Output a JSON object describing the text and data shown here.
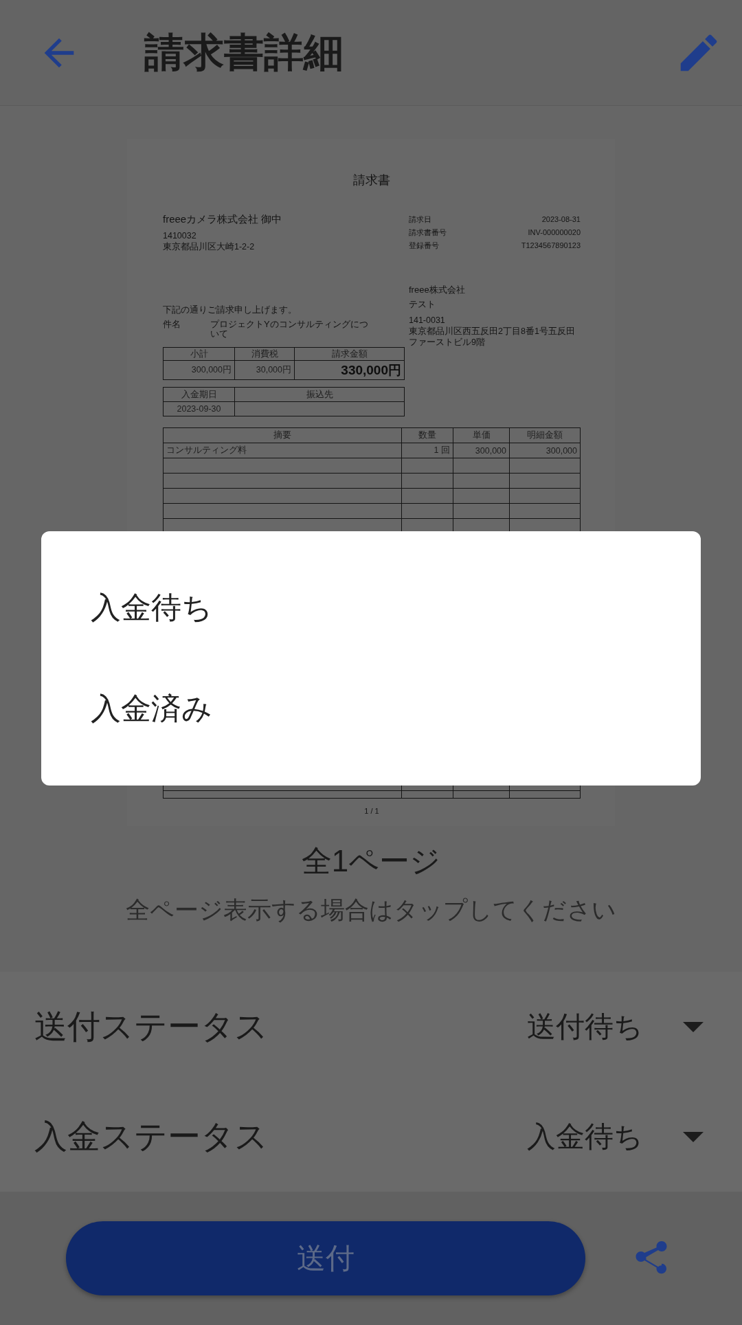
{
  "app_bar": {
    "title": "請求書詳細"
  },
  "document": {
    "title": "請求書",
    "recipient": {
      "name": "freeeカメラ株式会社 御中",
      "postal": "1410032",
      "address": "東京都品川区大崎1-2-2"
    },
    "meta": [
      {
        "label": "請求日",
        "value": "2023-08-31"
      },
      {
        "label": "請求書番号",
        "value": "INV-000000020"
      },
      {
        "label": "登録番号",
        "value": "T1234567890123"
      }
    ],
    "issuer": {
      "name": "freee株式会社",
      "department": "テスト",
      "postal": "141-0031",
      "address": "東京都品川区西五反田2丁目8番1号五反田ファーストビル9階"
    },
    "intro": "下記の通りご請求申し上げます。",
    "subject_label": "件名",
    "subject": "プロジェクトYのコンサルティングについて",
    "totals": {
      "headers": [
        "小計",
        "消費税",
        "請求金額"
      ],
      "values": [
        "300,000円",
        "30,000円",
        "330,000円"
      ]
    },
    "payment": {
      "due_label": "入金期日",
      "account_label": "振込先",
      "due_date": "2023-09-30"
    },
    "items": {
      "columns": [
        "摘要",
        "数量",
        "単価",
        "明細金額"
      ],
      "rows": [
        {
          "cells": [
            "コンサルティング料",
            "1 回",
            "300,000",
            "300,000"
          ]
        }
      ]
    },
    "page_indicator": "1 / 1"
  },
  "page_count": "全1ページ",
  "hint": "全ページ表示する場合はタップしてください",
  "statuses": [
    {
      "label": "送付ステータス",
      "value": "送付待ち"
    },
    {
      "label": "入金ステータス",
      "value": "入金待ち"
    }
  ],
  "send_button": "送付",
  "dialog": {
    "options": [
      {
        "label": "入金待ち"
      },
      {
        "label": "入金済み"
      }
    ]
  }
}
